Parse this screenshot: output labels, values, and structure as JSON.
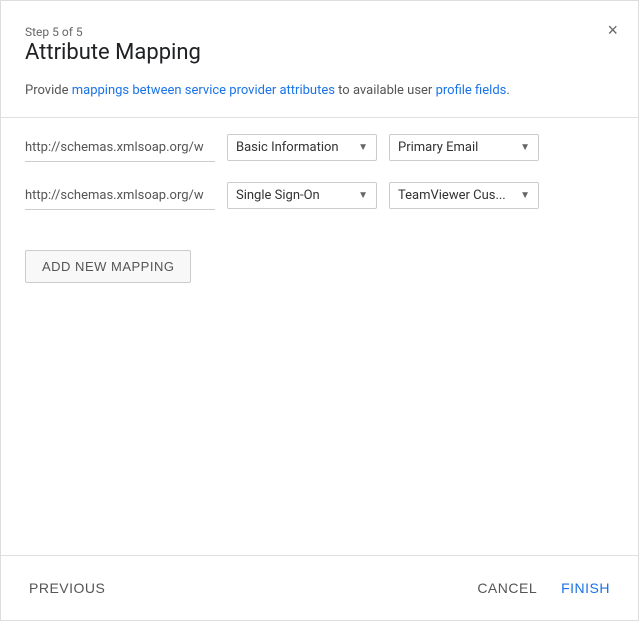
{
  "dialog": {
    "step_label": "Step 5 of 5",
    "title": "Attribute Mapping",
    "close_label": "×",
    "description_parts": [
      "Provide ",
      "mappings between service provider attributes",
      " to available user ",
      "profile fields",
      "."
    ]
  },
  "mappings": [
    {
      "url": "http://schemas.xmlsoap.org/w",
      "category": "Basic Information",
      "field": "Primary Email"
    },
    {
      "url": "http://schemas.xmlsoap.org/w",
      "category": "Single Sign-On",
      "field": "TeamViewer Cus..."
    }
  ],
  "buttons": {
    "add_mapping": "ADD NEW MAPPING",
    "previous": "PREVIOUS",
    "cancel": "CANCEL",
    "finish": "FINISH"
  },
  "colors": {
    "link": "#1a73e8",
    "text_muted": "#555",
    "cancel": "#555",
    "finish": "#1a73e8",
    "previous": "#555"
  }
}
